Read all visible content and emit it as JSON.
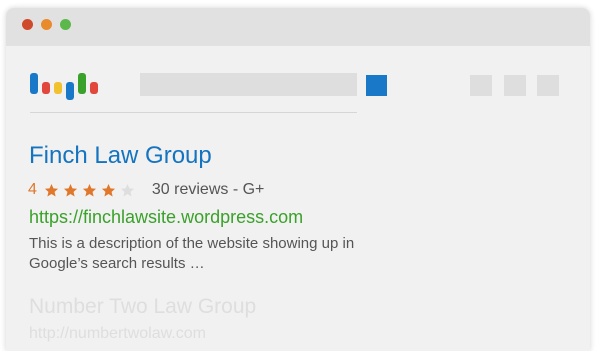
{
  "window": {
    "controls": [
      {
        "name": "close",
        "color": "#cf4a2c"
      },
      {
        "name": "minimize",
        "color": "#e98a2d"
      },
      {
        "name": "maximize",
        "color": "#5db84b"
      }
    ]
  },
  "logo": {
    "icon": "search-engine-logo",
    "colors": [
      "#1978c8",
      "#e2473b",
      "#f2c12e",
      "#1978c8",
      "#3aa12a",
      "#e2473b"
    ]
  },
  "search": {
    "button_color": "#1978c8"
  },
  "results": [
    {
      "title": "Finch Law Group",
      "rating": "4",
      "rating_value": 4,
      "rating_max": 5,
      "reviews": "30 reviews - G+",
      "url": "https://finchlawsite.wordpress.com",
      "description": "This is a description of the website showing up in Google’s search results …"
    },
    {
      "title": "Number Two Law Group",
      "url": "http://numbertwolaw.com"
    }
  ],
  "colors": {
    "title_link": "#1474c0",
    "url_green": "#3aa12a",
    "star_filled": "#e0772a",
    "star_empty": "#dedede"
  }
}
